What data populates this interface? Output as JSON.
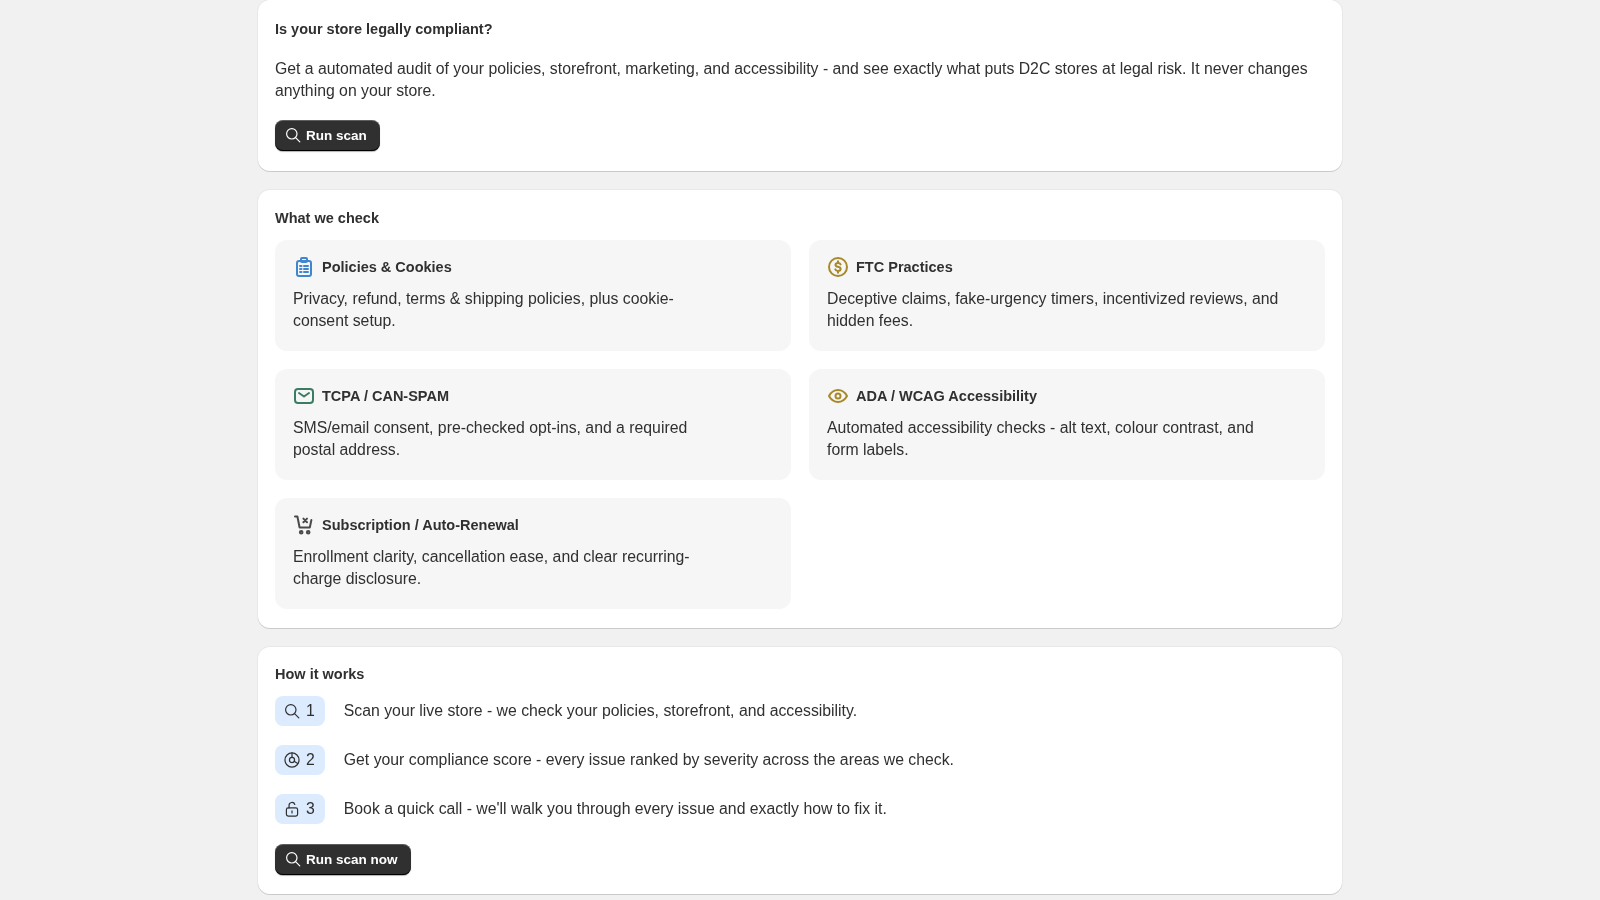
{
  "intro": {
    "title": "Is your store legally compliant?",
    "description": "Get a automated audit of your policies, storefront, marketing, and accessibility - and see exactly what puts D2C stores at legal risk. It never changes anything on your store.",
    "button": {
      "label": "Run scan"
    }
  },
  "checks": {
    "title": "What we check",
    "items": [
      {
        "title": "Policies & Cookies",
        "description": "Privacy, refund, terms & shipping policies, plus cookie-consent setup.",
        "color": "#3f86d0"
      },
      {
        "title": "FTC Practices",
        "description": "Deceptive claims, fake-urgency timers, incentivized reviews, and hidden fees.",
        "color": "#a8892a"
      },
      {
        "title": "TCPA / CAN-SPAM",
        "description": "SMS/email consent, pre-checked opt-ins, and a required postal address.",
        "color": "#3a7d62"
      },
      {
        "title": "ADA / WCAG Accessibility",
        "description": "Automated accessibility checks - alt text, colour contrast, and form labels.",
        "color": "#a8892a"
      },
      {
        "title": "Subscription / Auto-Renewal",
        "description": "Enrollment clarity, cancellation ease, and clear recurring-charge disclosure.",
        "color": "#4a4a4a"
      }
    ]
  },
  "how_it_works": {
    "title": "How it works",
    "steps": [
      {
        "number": "1",
        "text": "Scan your live store - we check your policies, storefront, and accessibility."
      },
      {
        "number": "2",
        "text": "Get your compliance score - every issue ranked by severity across the areas we check."
      },
      {
        "number": "3",
        "text": "Book a quick call - we'll walk you through every issue and exactly how to fix it."
      }
    ],
    "button": {
      "label": "Run scan now"
    }
  }
}
